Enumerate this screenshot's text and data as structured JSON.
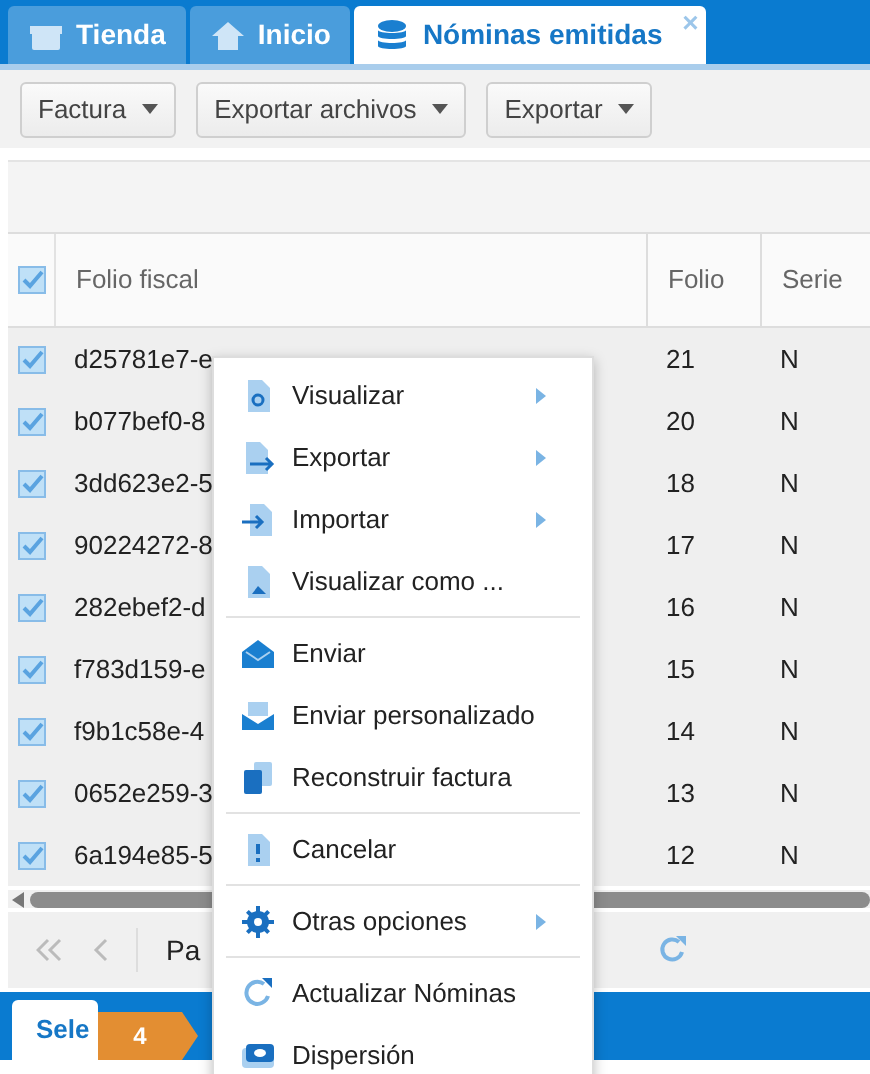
{
  "tabs": [
    {
      "label": "Tienda",
      "selected": false
    },
    {
      "label": "Inicio",
      "selected": false
    },
    {
      "label": "Nóminas emitidas",
      "selected": true,
      "close_glyph": "×"
    }
  ],
  "toolbar": {
    "buttons": [
      "Factura",
      "Exportar archivos",
      "Exportar"
    ]
  },
  "table": {
    "all_checked": true,
    "columns": [
      "Folio fiscal",
      "Folio",
      "Serie"
    ],
    "rows": [
      {
        "checked": true,
        "cells": [
          "d25781e7-e",
          "21",
          "N"
        ]
      },
      {
        "checked": true,
        "cells": [
          "b077bef0-8",
          "20",
          "N"
        ]
      },
      {
        "checked": true,
        "cells": [
          "3dd623e2-5",
          "18",
          "N"
        ]
      },
      {
        "checked": true,
        "cells": [
          "90224272-8",
          "17",
          "N"
        ]
      },
      {
        "checked": true,
        "cells": [
          "282ebef2-d",
          "16",
          "N"
        ]
      },
      {
        "checked": true,
        "cells": [
          "f783d159-e",
          "15",
          "N"
        ]
      },
      {
        "checked": true,
        "cells": [
          "f9b1c58e-4",
          "14",
          "N"
        ]
      },
      {
        "checked": true,
        "cells": [
          "0652e259-3",
          "13",
          "N"
        ]
      },
      {
        "checked": true,
        "cells": [
          "6a194e85-5",
          "12",
          "N"
        ]
      }
    ]
  },
  "paging": {
    "label": "Pa"
  },
  "bottom_tab": {
    "label": "Sele"
  },
  "step_marker": {
    "label": "4"
  },
  "context_menu": [
    {
      "kind": "item",
      "label": "Visualizar",
      "submenu": true
    },
    {
      "kind": "item",
      "label": "Exportar",
      "submenu": true
    },
    {
      "kind": "item",
      "label": "Importar",
      "submenu": true
    },
    {
      "kind": "item",
      "label": "Visualizar como ...",
      "submenu": false
    },
    {
      "kind": "separator"
    },
    {
      "kind": "item",
      "label": "Enviar",
      "submenu": false
    },
    {
      "kind": "item",
      "label": "Enviar personalizado",
      "submenu": false
    },
    {
      "kind": "item",
      "label": "Reconstruir factura",
      "submenu": false
    },
    {
      "kind": "separator"
    },
    {
      "kind": "item",
      "label": "Cancelar",
      "submenu": false
    },
    {
      "kind": "separator"
    },
    {
      "kind": "item",
      "label": "Otras opciones",
      "submenu": true
    },
    {
      "kind": "separator"
    },
    {
      "kind": "item",
      "label": "Actualizar Nóminas",
      "submenu": false
    },
    {
      "kind": "item",
      "label": "Dispersión",
      "submenu": false
    }
  ]
}
